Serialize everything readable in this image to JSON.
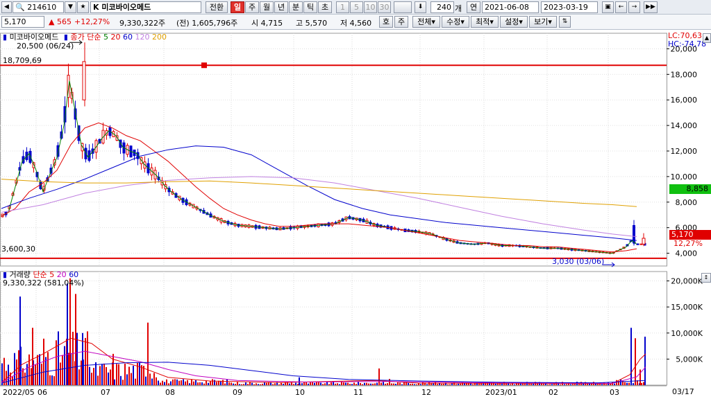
{
  "toolbar": {
    "code": "214610",
    "name": "K 미코바이오메드",
    "convert_label": "전환",
    "period_tabs": [
      "일",
      "주",
      "월",
      "년",
      "분",
      "틱",
      "초"
    ],
    "active_period": "일",
    "minute_tabs": [
      "1",
      "5",
      "10",
      "30"
    ],
    "count_value": "240",
    "count_unit": "개",
    "date_mode": "연",
    "start_date": "2021-06-08",
    "end_date": "2023-03-19"
  },
  "quote": {
    "price": "5,170",
    "change": "565",
    "change_rate": "+12,27%",
    "volume": "9,330,322주",
    "prev_volume": "(전) 1,605,796주",
    "open_label": "시",
    "open": "4,715",
    "high_label": "고",
    "high": "5,570",
    "low_label": "저",
    "low": "4,560",
    "buttons": [
      "호",
      "주",
      "전체",
      "수정",
      "최적",
      "설정",
      "보기"
    ]
  },
  "price_panel": {
    "legend_name": "미코바이오메드",
    "legend_ma_label": "종가 단순",
    "ma_periods": [
      "5",
      "20",
      "60",
      "120",
      "200"
    ],
    "ma_colors": [
      "#008000",
      "#e00000",
      "#0000cc",
      "#c080e0",
      "#e0a000"
    ],
    "lc": "LC:70,63",
    "hc": "HC:-74,78",
    "y_ticks": [
      "20,000",
      "18,000",
      "16,000",
      "14,000",
      "12,000",
      "10,000",
      "8,000",
      "6,000",
      "4,000"
    ],
    "hline_high_label": "18,709,69",
    "hline_low_label": "3,600,30",
    "max_annotation": "20,500 (06/24)",
    "min_annotation": "3,030 (03/06)",
    "price_tag": "5,170",
    "rate_tag": "12,27%",
    "green_tag": "8,858"
  },
  "volume_panel": {
    "legend_name": "거래량",
    "legend_ma_label": "단순",
    "ma_periods": [
      "5",
      "20",
      "60"
    ],
    "value_text": "9,330,322 (581,04%)",
    "y_ticks": [
      "20,000K",
      "15,000K",
      "10,000K",
      "5,000K"
    ]
  },
  "x_axis": {
    "labels": [
      "2022/05",
      "06",
      "07",
      "08",
      "09",
      "10",
      "11",
      "12",
      "2023/01",
      "02",
      "03"
    ],
    "end_label": "03/17"
  },
  "chart_data": {
    "type": "candlestick",
    "price_y_range": [
      3000,
      21000
    ],
    "volume_y_range": [
      0,
      21000
    ],
    "price_hlines": [
      18709.69,
      3600.3
    ],
    "ma_series": [
      {
        "name": "5",
        "color": "#008000",
        "points": [
          [
            0,
            6900
          ],
          [
            10,
            7200
          ],
          [
            20,
            9200
          ],
          [
            30,
            11200
          ],
          [
            40,
            11800
          ],
          [
            50,
            10500
          ],
          [
            60,
            8800
          ],
          [
            70,
            10200
          ],
          [
            80,
            11500
          ],
          [
            90,
            14000
          ],
          [
            98,
            17500
          ],
          [
            105,
            15500
          ],
          [
            115,
            12500
          ],
          [
            125,
            11500
          ],
          [
            135,
            12200
          ],
          [
            145,
            13000
          ],
          [
            155,
            13600
          ],
          [
            165,
            13200
          ],
          [
            175,
            12300
          ],
          [
            185,
            12000
          ],
          [
            195,
            11800
          ],
          [
            205,
            11000
          ],
          [
            215,
            10500
          ],
          [
            225,
            10000
          ],
          [
            235,
            9300
          ],
          [
            245,
            8800
          ],
          [
            260,
            8200
          ],
          [
            280,
            7600
          ],
          [
            300,
            7000
          ],
          [
            320,
            6500
          ],
          [
            340,
            6200
          ],
          [
            360,
            6100
          ],
          [
            380,
            6000
          ],
          [
            400,
            5900
          ],
          [
            420,
            6000
          ],
          [
            440,
            6100
          ],
          [
            460,
            6200
          ],
          [
            480,
            6300
          ],
          [
            500,
            6800
          ],
          [
            520,
            6600
          ],
          [
            540,
            6200
          ],
          [
            560,
            6000
          ],
          [
            580,
            5800
          ],
          [
            600,
            5700
          ],
          [
            620,
            5500
          ],
          [
            640,
            5100
          ],
          [
            660,
            4800
          ],
          [
            680,
            4700
          ],
          [
            700,
            4800
          ],
          [
            720,
            4600
          ],
          [
            740,
            4600
          ],
          [
            760,
            4500
          ],
          [
            780,
            4400
          ],
          [
            800,
            4400
          ],
          [
            820,
            4300
          ],
          [
            840,
            4200
          ],
          [
            860,
            4100
          ],
          [
            880,
            4000
          ],
          [
            900,
            4500
          ],
          [
            908,
            5000
          ],
          [
            915,
            4700
          ]
        ]
      },
      {
        "name": "20",
        "color": "#e00000",
        "points": [
          [
            0,
            6900
          ],
          [
            20,
            7500
          ],
          [
            40,
            8800
          ],
          [
            60,
            9500
          ],
          [
            80,
            10500
          ],
          [
            100,
            12500
          ],
          [
            120,
            13800
          ],
          [
            140,
            14200
          ],
          [
            160,
            13800
          ],
          [
            180,
            13200
          ],
          [
            200,
            12800
          ],
          [
            220,
            12000
          ],
          [
            240,
            11200
          ],
          [
            260,
            10200
          ],
          [
            280,
            9200
          ],
          [
            300,
            8300
          ],
          [
            320,
            7500
          ],
          [
            340,
            7000
          ],
          [
            360,
            6600
          ],
          [
            380,
            6300
          ],
          [
            400,
            6100
          ],
          [
            420,
            6100
          ],
          [
            440,
            6200
          ],
          [
            460,
            6300
          ],
          [
            480,
            6300
          ],
          [
            500,
            6300
          ],
          [
            520,
            6200
          ],
          [
            540,
            6100
          ],
          [
            560,
            6000
          ],
          [
            580,
            5800
          ],
          [
            600,
            5600
          ],
          [
            620,
            5400
          ],
          [
            640,
            5200
          ],
          [
            660,
            5000
          ],
          [
            680,
            4900
          ],
          [
            700,
            4800
          ],
          [
            720,
            4700
          ],
          [
            740,
            4600
          ],
          [
            760,
            4600
          ],
          [
            780,
            4500
          ],
          [
            800,
            4500
          ],
          [
            820,
            4400
          ],
          [
            840,
            4300
          ],
          [
            860,
            4200
          ],
          [
            880,
            4100
          ],
          [
            900,
            4200
          ],
          [
            915,
            4350
          ]
        ]
      },
      {
        "name": "60",
        "color": "#0000cc",
        "points": [
          [
            0,
            7500
          ],
          [
            40,
            8300
          ],
          [
            80,
            9000
          ],
          [
            120,
            9800
          ],
          [
            160,
            10700
          ],
          [
            200,
            11600
          ],
          [
            240,
            12100
          ],
          [
            280,
            12400
          ],
          [
            320,
            12300
          ],
          [
            360,
            11700
          ],
          [
            400,
            10500
          ],
          [
            440,
            9300
          ],
          [
            480,
            8200
          ],
          [
            520,
            7500
          ],
          [
            560,
            7000
          ],
          [
            600,
            6700
          ],
          [
            640,
            6400
          ],
          [
            680,
            6200
          ],
          [
            720,
            6000
          ],
          [
            760,
            5800
          ],
          [
            800,
            5600
          ],
          [
            840,
            5400
          ],
          [
            880,
            5200
          ],
          [
            915,
            5000
          ]
        ]
      },
      {
        "name": "120",
        "color": "#c080e0",
        "points": [
          [
            0,
            7200
          ],
          [
            60,
            7800
          ],
          [
            120,
            8700
          ],
          [
            180,
            9300
          ],
          [
            240,
            9700
          ],
          [
            300,
            9900
          ],
          [
            360,
            10000
          ],
          [
            420,
            9900
          ],
          [
            480,
            9500
          ],
          [
            540,
            8900
          ],
          [
            600,
            8300
          ],
          [
            660,
            7600
          ],
          [
            720,
            6900
          ],
          [
            780,
            6300
          ],
          [
            840,
            5800
          ],
          [
            880,
            5500
          ],
          [
            915,
            5300
          ]
        ]
      },
      {
        "name": "200",
        "color": "#e0a000",
        "points": [
          [
            0,
            9800
          ],
          [
            60,
            9600
          ],
          [
            120,
            9500
          ],
          [
            180,
            9500
          ],
          [
            240,
            9600
          ],
          [
            300,
            9650
          ],
          [
            360,
            9500
          ],
          [
            420,
            9300
          ],
          [
            480,
            9100
          ],
          [
            540,
            8900
          ],
          [
            600,
            8700
          ],
          [
            660,
            8500
          ],
          [
            720,
            8300
          ],
          [
            780,
            8100
          ],
          [
            840,
            7900
          ],
          [
            880,
            7800
          ],
          [
            915,
            7650
          ]
        ]
      }
    ],
    "volume_ma_series": [
      {
        "name": "5",
        "color": "#e00000"
      },
      {
        "name": "20",
        "color": "#c000c0"
      },
      {
        "name": "60",
        "color": "#0000cc"
      }
    ]
  }
}
